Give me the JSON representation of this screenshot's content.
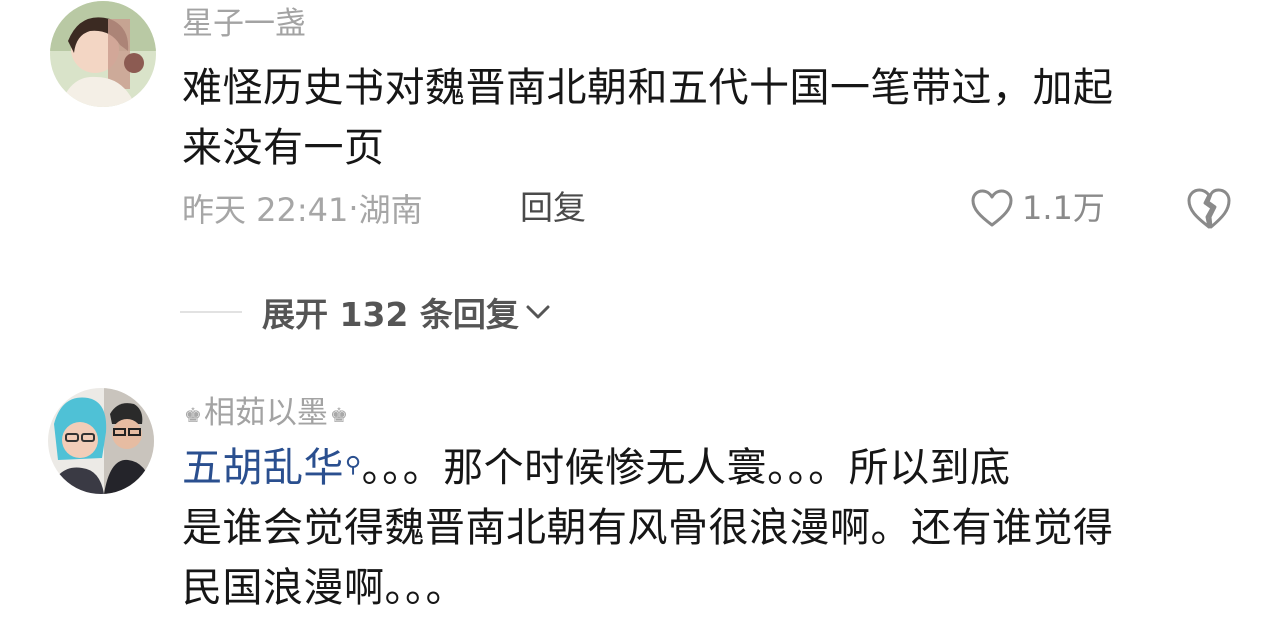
{
  "comments": [
    {
      "username": "星子一盏",
      "text_lines": [
        "难怪历史书对魏晋南北朝和五代十国一笔带过，加起",
        "来没有一页"
      ],
      "time": "昨天 22:41",
      "location_sep": "·",
      "location": "湖南",
      "reply_label": "回复",
      "likes": "1.1万",
      "expand_label": "展开 132 条回复"
    },
    {
      "username": "相茹以墨",
      "topic_link": "五胡乱华",
      "text_line1_rest": "。。。那个时候惨无人寰。。。所以到底",
      "text_line2": "是谁会觉得魏晋南北朝有风骨很浪漫啊。还有谁觉得",
      "text_line3": "民国浪漫啊。。。"
    }
  ],
  "icons": {
    "like": "heart-outline-icon",
    "dislike": "broken-heart-icon",
    "expand": "chevron-down-icon",
    "topic": "search-icon",
    "badge": "crown-icon"
  },
  "colors": {
    "text": "#161616",
    "secondary": "#a6a6a6",
    "link": "#2a4f8f"
  }
}
